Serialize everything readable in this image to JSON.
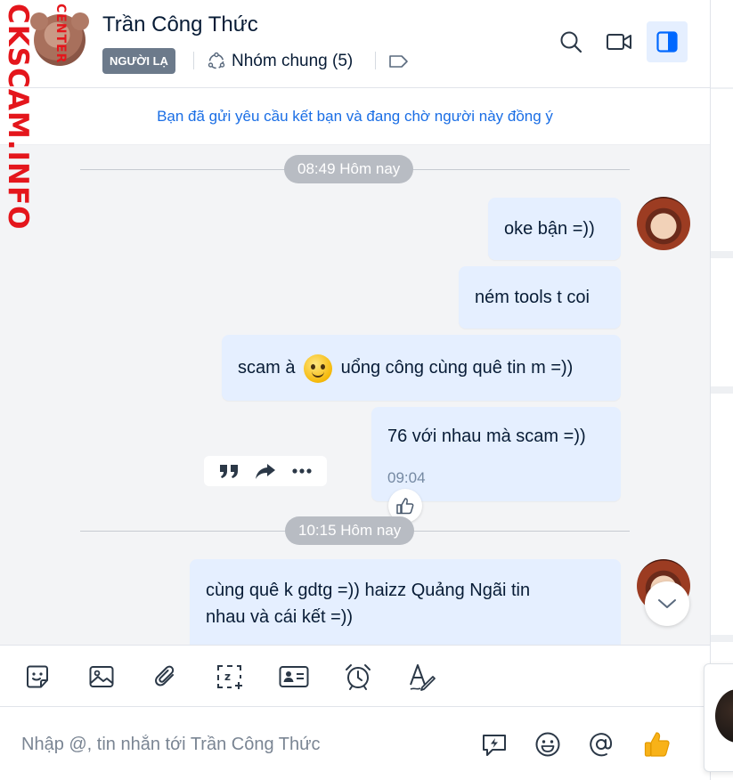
{
  "header": {
    "name": "Trần Công Thức",
    "stranger_tag": "NGƯỜI LẠ",
    "groups_label": "Nhóm chung (5)",
    "icons": [
      "search-icon",
      "video-call-icon",
      "sidebar-toggle-icon",
      "tag-icon",
      "group-icon"
    ]
  },
  "notice": "Bạn đã gửi yêu cầu kết bạn và đang chờ người này đồng ý",
  "chat": {
    "separators": [
      "08:49 Hôm nay",
      "10:15 Hôm nay"
    ],
    "messages": [
      {
        "text": "oke bận =))"
      },
      {
        "text": "ném tools t coi"
      },
      {
        "before": "scam à",
        "emoji": "smile-emoji",
        "after": "uổng công cùng quê tin m =))"
      },
      {
        "text": "76 với nhau mà scam =))",
        "time": "09:04"
      },
      {
        "line1": "cùng quê k gdtg =)) haizz Quảng Ngãi tin",
        "line2": "nhau và cái kết =))"
      }
    ],
    "actions": [
      "quote-icon",
      "share-icon",
      "more-icon"
    ]
  },
  "toolbar": [
    "sticker-icon",
    "image-icon",
    "attachment-icon",
    "screenshot-icon",
    "contact-card-icon",
    "reminder-icon",
    "format-icon"
  ],
  "composer": {
    "placeholder": "Nhập @, tin nhắn tới Trần Công Thức",
    "icons": [
      "quick-message-icon",
      "emoji-icon",
      "mention-icon",
      "thumbs-up-icon"
    ]
  },
  "watermark": {
    "main": "CKSCAM.INFO",
    "sub": "CENTER"
  },
  "colors": {
    "accent": "#1a6ee5",
    "bubble": "#e5efff",
    "chat_bg": "#f3f4f6",
    "stranger_tag": "#6c7a8b",
    "watermark": "#e4161c"
  }
}
